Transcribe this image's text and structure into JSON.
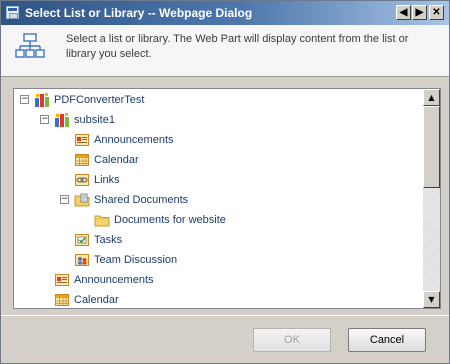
{
  "window": {
    "title": "Select List or Library -- Webpage Dialog",
    "controls": {
      "back_glyph": "◀",
      "forward_glyph": "▶",
      "close_glyph": "✕"
    }
  },
  "header": {
    "icon": "site-hierarchy-icon",
    "description": "Select a list or library. The Web Part will display content from the list or library you select."
  },
  "tree": {
    "rows": [
      {
        "label": "PDFConverterTest",
        "icon": "site-icon",
        "level": 0,
        "expander": "−"
      },
      {
        "label": "subsite1",
        "icon": "site-icon",
        "level": 1,
        "expander": "−"
      },
      {
        "label": "Announcements",
        "icon": "announcements-list-icon",
        "level": 2
      },
      {
        "label": "Calendar",
        "icon": "calendar-list-icon",
        "level": 2
      },
      {
        "label": "Links",
        "icon": "links-list-icon",
        "level": 2
      },
      {
        "label": "Shared Documents",
        "icon": "document-library-icon",
        "level": 2,
        "expander": "−"
      },
      {
        "label": "Documents for website",
        "icon": "folder-icon",
        "level": 3
      },
      {
        "label": "Tasks",
        "icon": "tasks-list-icon",
        "level": 2
      },
      {
        "label": "Team Discussion",
        "icon": "discussion-list-icon",
        "level": 2
      },
      {
        "label": "Announcements",
        "icon": "announcements-list-icon",
        "level": 1
      },
      {
        "label": "Calendar",
        "icon": "calendar-list-icon",
        "level": 1
      }
    ]
  },
  "scrollbar": {
    "up_glyph": "▲",
    "down_glyph": "▼"
  },
  "buttons": {
    "ok": {
      "label": "OK",
      "enabled": false
    },
    "cancel": {
      "label": "Cancel",
      "enabled": true
    }
  },
  "colors": {
    "title_gradient_start": "#2f5486",
    "title_gradient_end": "#a8c4e6",
    "tree_text": "#1e3c6e",
    "dialog_background": "#d4d0c8"
  }
}
